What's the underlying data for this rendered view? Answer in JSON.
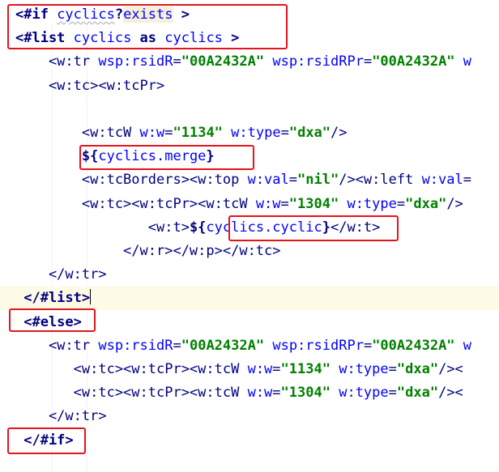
{
  "editor": {
    "lines": [
      [
        {
          "t": "<#if ",
          "c": "ftl"
        },
        {
          "t": "cyclics",
          "c": "fv squig"
        },
        {
          "t": "?",
          "c": "ftl"
        },
        {
          "t": "exists",
          "c": "fv hl"
        },
        {
          "t": " >",
          "c": "ftl"
        }
      ],
      [
        {
          "t": "<#list ",
          "c": "ftl"
        },
        {
          "t": "cyclics",
          "c": "fv"
        },
        {
          "t": " as ",
          "c": "kw"
        },
        {
          "t": "cyclics",
          "c": "fv"
        },
        {
          "t": " >",
          "c": "ftl"
        }
      ],
      [
        {
          "t": "    <w:tr ",
          "c": "tag"
        },
        {
          "t": "wsp:rsidR",
          "c": "an"
        },
        {
          "t": "=",
          "c": "tag"
        },
        {
          "t": "\"00A2432A\"",
          "c": "av"
        },
        {
          "t": " ",
          "c": "tag"
        },
        {
          "t": "wsp:rsidRPr",
          "c": "an"
        },
        {
          "t": "=",
          "c": "tag"
        },
        {
          "t": "\"00A2432A\"",
          "c": "av"
        },
        {
          "t": " w",
          "c": "an"
        }
      ],
      [
        {
          "t": "    <w:tc><w:tcPr>",
          "c": "tag"
        }
      ],
      [],
      [
        {
          "t": "        <w:tcW ",
          "c": "tag"
        },
        {
          "t": "w:w",
          "c": "an"
        },
        {
          "t": "=",
          "c": "tag"
        },
        {
          "t": "\"1134\"",
          "c": "av"
        },
        {
          "t": " ",
          "c": "tag"
        },
        {
          "t": "w:type",
          "c": "an"
        },
        {
          "t": "=",
          "c": "tag"
        },
        {
          "t": "\"dxa\"",
          "c": "av"
        },
        {
          "t": "/>",
          "c": "tag"
        }
      ],
      [
        {
          "t": "        ${",
          "c": "ftl"
        },
        {
          "t": "cyclics.merge",
          "c": "fv"
        },
        {
          "t": "}",
          "c": "ftl"
        }
      ],
      [
        {
          "t": "        <w:tcBorders><w:top ",
          "c": "tag"
        },
        {
          "t": "w:val",
          "c": "an"
        },
        {
          "t": "=",
          "c": "tag"
        },
        {
          "t": "\"nil\"",
          "c": "av"
        },
        {
          "t": "/><w:left ",
          "c": "tag"
        },
        {
          "t": "w:val",
          "c": "an"
        },
        {
          "t": "=",
          "c": "tag"
        }
      ],
      [
        {
          "t": "        <w:tc><w:tcPr><w:tcW ",
          "c": "tag"
        },
        {
          "t": "w:w",
          "c": "an"
        },
        {
          "t": "=",
          "c": "tag"
        },
        {
          "t": "\"1304\"",
          "c": "av"
        },
        {
          "t": " ",
          "c": "tag"
        },
        {
          "t": "w:type",
          "c": "an"
        },
        {
          "t": "=",
          "c": "tag"
        },
        {
          "t": "\"dxa\"",
          "c": "av"
        },
        {
          "t": "/>",
          "c": "tag"
        }
      ],
      [
        {
          "t": "                <w:t>",
          "c": "tag"
        },
        {
          "t": "${",
          "c": "ftl"
        },
        {
          "t": "cyclics.cyclic",
          "c": "fv"
        },
        {
          "t": "}",
          "c": "ftl"
        },
        {
          "t": "</w:t>",
          "c": "tag"
        }
      ],
      [
        {
          "t": "             </w:r></w:p></w:tc>",
          "c": "tag"
        }
      ],
      [
        {
          "t": "    </w:tr>",
          "c": "tag"
        }
      ],
      [
        {
          "t": " </#list>",
          "c": "ftl"
        },
        {
          "caret": true
        }
      ],
      [
        {
          "t": " <#else>",
          "c": "ftl"
        }
      ],
      [
        {
          "t": "    <w:tr ",
          "c": "tag"
        },
        {
          "t": "wsp:rsidR",
          "c": "an"
        },
        {
          "t": "=",
          "c": "tag"
        },
        {
          "t": "\"00A2432A\"",
          "c": "av"
        },
        {
          "t": " ",
          "c": "tag"
        },
        {
          "t": "wsp:rsidRPr",
          "c": "an"
        },
        {
          "t": "=",
          "c": "tag"
        },
        {
          "t": "\"00A2432A\"",
          "c": "av"
        },
        {
          "t": " w",
          "c": "an"
        }
      ],
      [
        {
          "t": "       <w:tc><w:tcPr><w:tcW ",
          "c": "tag"
        },
        {
          "t": "w:w",
          "c": "an"
        },
        {
          "t": "=",
          "c": "tag"
        },
        {
          "t": "\"1134\"",
          "c": "av"
        },
        {
          "t": " ",
          "c": "tag"
        },
        {
          "t": "w:type",
          "c": "an"
        },
        {
          "t": "=",
          "c": "tag"
        },
        {
          "t": "\"dxa\"",
          "c": "av"
        },
        {
          "t": "/><",
          "c": "tag"
        }
      ],
      [
        {
          "t": "       <w:tc><w:tcPr><w:tcW ",
          "c": "tag"
        },
        {
          "t": "w:w",
          "c": "an"
        },
        {
          "t": "=",
          "c": "tag"
        },
        {
          "t": "\"1304\"",
          "c": "av"
        },
        {
          "t": " ",
          "c": "tag"
        },
        {
          "t": "w:type",
          "c": "an"
        },
        {
          "t": "=",
          "c": "tag"
        },
        {
          "t": "\"dxa\"",
          "c": "av"
        },
        {
          "t": "/><",
          "c": "tag"
        }
      ],
      [
        {
          "t": "    </w:tr>",
          "c": "tag"
        }
      ],
      [
        {
          "t": " </#if>",
          "c": "ftl"
        }
      ]
    ],
    "current_line": 12
  },
  "colors": {
    "tag": "#000080",
    "attribute_name": "#0000ff",
    "attribute_value": "#008000",
    "annotation_box": "#e4141b",
    "current_line_bg": "#fdfbe6"
  }
}
